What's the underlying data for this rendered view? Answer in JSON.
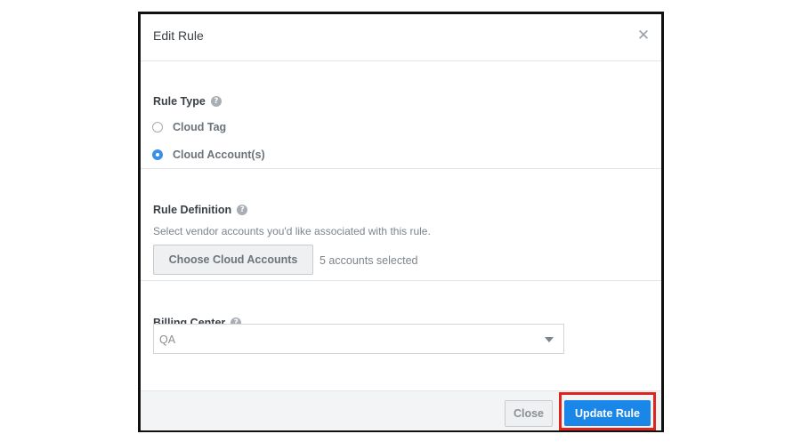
{
  "modal": {
    "title": "Edit Rule",
    "close_icon": "close-icon"
  },
  "rule_type": {
    "label": "Rule Type",
    "help": "?",
    "options": [
      {
        "label": "Cloud Tag",
        "checked": false
      },
      {
        "label": "Cloud Account(s)",
        "checked": true
      }
    ]
  },
  "rule_definition": {
    "label": "Rule Definition",
    "help": "?",
    "description": "Select vendor accounts you'd like associated with this rule.",
    "button_label": "Choose Cloud Accounts",
    "selected_text": "5 accounts selected"
  },
  "billing_center": {
    "label": "Billing Center",
    "help": "?",
    "selected_value": "QA"
  },
  "footer": {
    "close_label": "Close",
    "update_label": "Update Rule"
  },
  "colors": {
    "accent": "#1a86e8",
    "highlight": "#e1231d"
  }
}
